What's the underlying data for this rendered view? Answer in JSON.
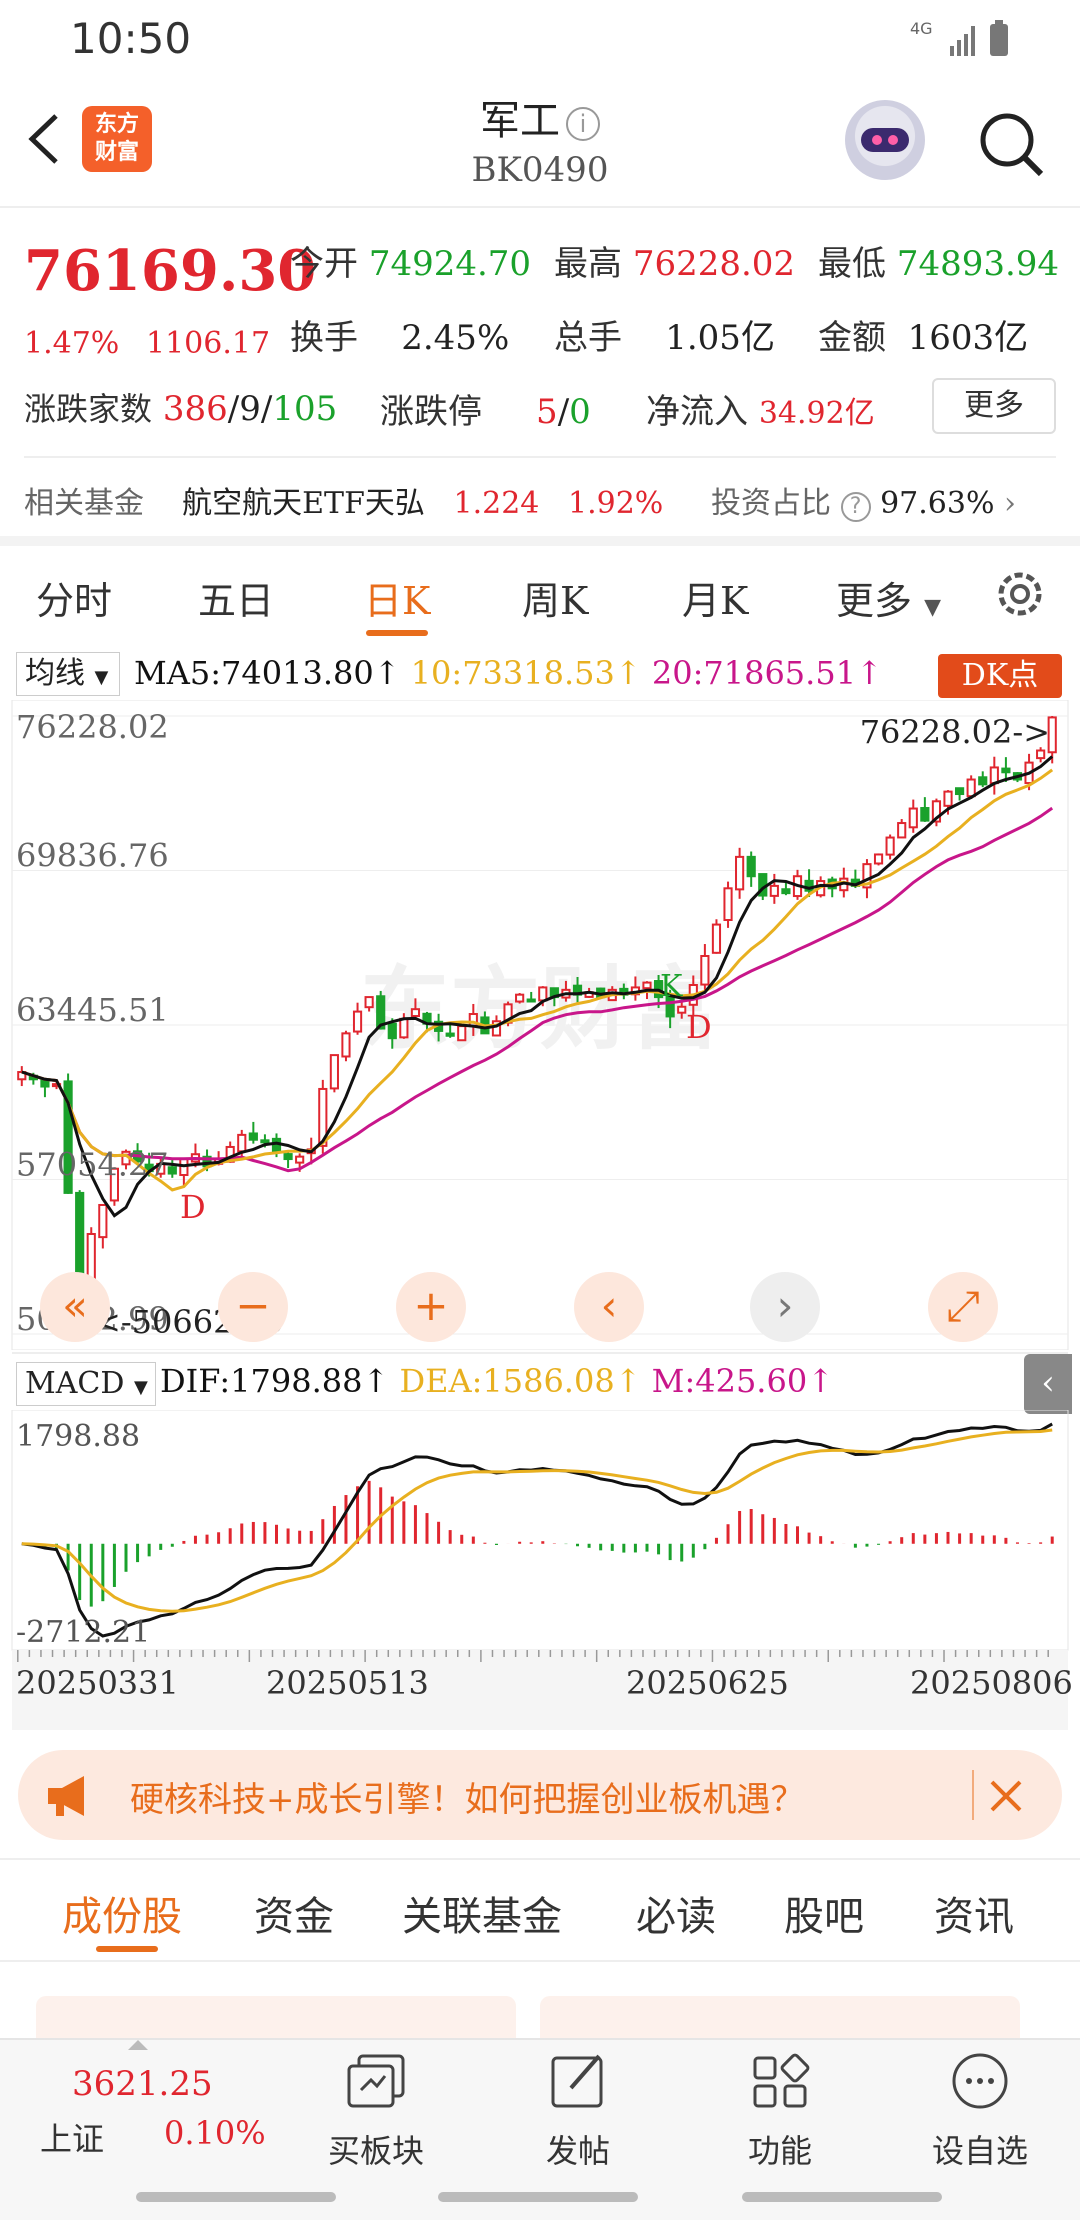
{
  "status": {
    "time": "10:50",
    "network": "4G"
  },
  "header": {
    "logo_line1": "东方",
    "logo_line2": "财富",
    "title": "军工",
    "code": "BK0490"
  },
  "quote": {
    "price": "76169.30",
    "pct": "1.47%",
    "change": "1106.17",
    "open_label": "今开",
    "open": "74924.70",
    "high_label": "最高",
    "high": "76228.02",
    "low_label": "最低",
    "low": "74893.94",
    "turnover_label": "换手",
    "turnover": "2.45%",
    "volume_label": "总手",
    "volume": "1.05亿",
    "amount_label": "金额",
    "amount": "1603亿",
    "breadth_label": "涨跌家数",
    "up_count": "386",
    "flat_count": "9",
    "down_count": "105",
    "limit_label": "涨跌停",
    "limit_up": "5",
    "limit_down": "0",
    "inflow_label": "净流入",
    "inflow": "34.92亿",
    "more_label": "更多"
  },
  "fund": {
    "label": "相关基金",
    "name": "航空航天ETF天弘",
    "price": "1.224",
    "pct": "1.92%",
    "ratio_label": "投资占比",
    "ratio": "97.63%"
  },
  "period_tabs": {
    "t1": "分时",
    "t2": "五日",
    "t3": "日K",
    "t4": "周K",
    "t5": "月K",
    "t6": "更多"
  },
  "ma_bar": {
    "select": "均线",
    "ma5": "MA5:74013.80↑",
    "ma10": "10:73318.53↑",
    "ma20": "20:71865.51↑",
    "dk": "DK点"
  },
  "kchart": {
    "y_labels": [
      "76228.02",
      "69836.76",
      "63445.51",
      "57054.27",
      "50662.99"
    ],
    "high_marker": "76228.02->",
    "low_marker": "<-50662.99",
    "signals": [
      "D",
      "K",
      "D"
    ],
    "watermark": "东方财富"
  },
  "chart_data": {
    "type": "candlestick",
    "ylim": [
      50662.99,
      76228.02
    ],
    "series": [
      {
        "name": "MA5",
        "color": "#111111"
      },
      {
        "name": "MA10",
        "color": "#e8b020"
      },
      {
        "name": "MA20",
        "color": "#c8168a"
      }
    ],
    "close": [
      61500,
      61200,
      60900,
      61000,
      56500,
      53000,
      54800,
      56000,
      57500,
      58200,
      57800,
      57400,
      57700,
      57300,
      57900,
      58100,
      57600,
      57900,
      58400,
      58900,
      58700,
      58600,
      58200,
      57900,
      58000,
      58300,
      60800,
      62200,
      63100,
      64000,
      64600,
      63300,
      62900,
      63700,
      64100,
      63500,
      63200,
      63000,
      63400,
      63900,
      63100,
      63600,
      64300,
      64700,
      64500,
      65000,
      64600,
      64900,
      64700,
      64800,
      64600,
      64900,
      64700,
      65000,
      65200,
      64600,
      63800,
      64200,
      65100,
      66300,
      67600,
      69100,
      70400,
      69600,
      68800,
      69200,
      68900,
      69600,
      69000,
      69400,
      69100,
      69500,
      69200,
      70100,
      70500,
      71200,
      71800,
      72400,
      71900,
      72700,
      73100,
      73000,
      73600,
      73400,
      74100,
      73900,
      73600,
      74300,
      74800,
      76169
    ]
  },
  "controls": {
    "prev": "«",
    "zoom_out": "−",
    "zoom_in": "+",
    "left": "‹",
    "right": "›",
    "expand": "⤢"
  },
  "macd": {
    "select": "MACD",
    "dif": "DIF:1798.88↑",
    "dea": "DEA:1586.08↑",
    "m": "M:425.60↑",
    "y_top": "1798.88",
    "y_bottom": "-2712.21"
  },
  "dates": {
    "d1": "20250331",
    "d2": "20250513",
    "d3": "20250625",
    "d4": "20250806"
  },
  "banner": {
    "text": "硬核科技+成长引擎！如何把握创业板机遇？"
  },
  "bottom_tabs": {
    "t1": "成份股",
    "t2": "资金",
    "t3": "关联基金",
    "t4": "必读",
    "t5": "股吧",
    "t6": "资讯"
  },
  "bottom_nav": {
    "index_value": "3621.25",
    "index_name": "上证",
    "index_pct": "0.10%",
    "n2": "买板块",
    "n3": "发帖",
    "n4": "功能",
    "n5": "设自选"
  },
  "colors": {
    "up": "#e0262f",
    "down": "#1aa12b",
    "accent": "#e86d1c"
  }
}
